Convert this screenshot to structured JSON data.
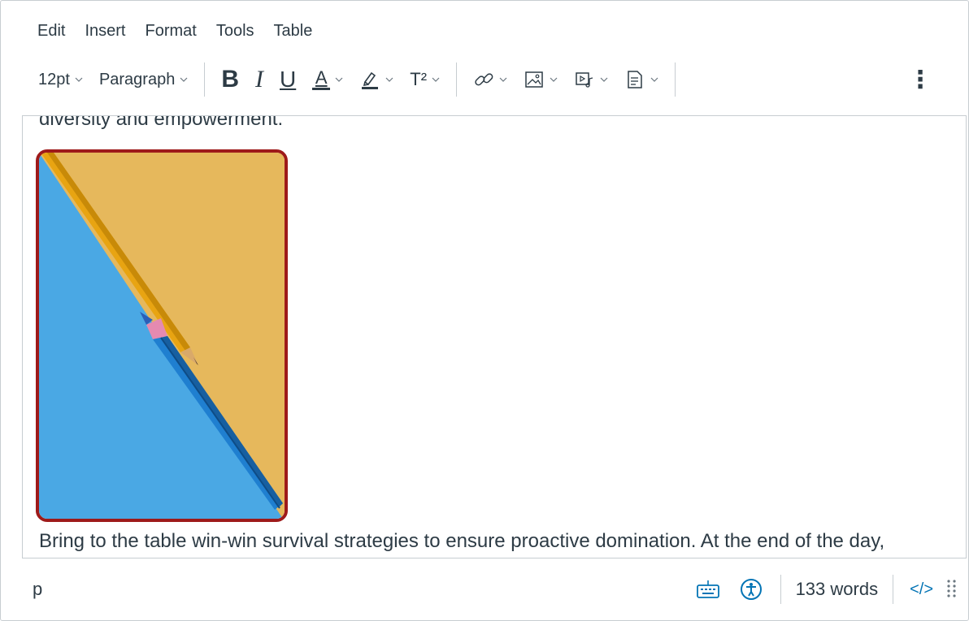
{
  "menubar": {
    "items": [
      "Edit",
      "Insert",
      "Format",
      "Tools",
      "Table"
    ]
  },
  "toolbar": {
    "font_size": "12pt",
    "block_format": "Paragraph",
    "bold": "B",
    "italic": "I",
    "underline": "U",
    "text_color": "A",
    "superscript": "T²",
    "more": "⋮"
  },
  "content": {
    "top_text": "diversity and empowerment.",
    "bottom_text": "Bring to the table win-win survival strategies to ensure proactive domination. At the end of the day,",
    "image": {
      "border_color": "#9e1a1a"
    }
  },
  "statusbar": {
    "path": "p",
    "word_count": "133 words",
    "html_toggle": "</>"
  },
  "colors": {
    "accent": "#0374b5",
    "text": "#2d3b45",
    "border": "#c7cdd1"
  }
}
